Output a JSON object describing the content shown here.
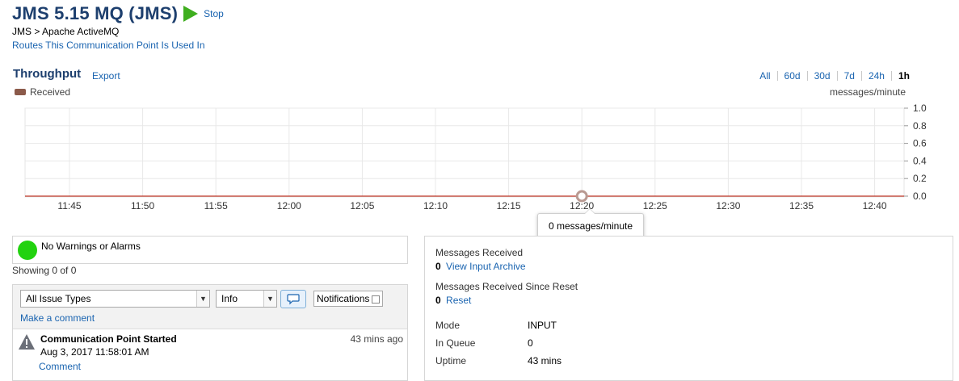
{
  "header": {
    "title": "JMS 5.15 MQ (JMS)",
    "stop_label": "Stop",
    "breadcrumb": "JMS > Apache ActiveMQ",
    "routes_link": "Routes This Communication Point Is Used In"
  },
  "throughput": {
    "title": "Throughput",
    "export_label": "Export",
    "ranges": [
      "All",
      "60d",
      "30d",
      "7d",
      "24h",
      "1h"
    ],
    "active_range": "1h",
    "legend_label": "Received",
    "legend_color": "#8b5a4a",
    "unit_label": "messages/minute",
    "tooltip": "0 messages/minute"
  },
  "chart_data": {
    "type": "line",
    "x_ticks": [
      "11:45",
      "11:50",
      "11:55",
      "12:00",
      "12:05",
      "12:10",
      "12:15",
      "12:20",
      "12:25",
      "12:30",
      "12:35",
      "12:40"
    ],
    "y_ticks": [
      "0.0",
      "0.2",
      "0.4",
      "0.6",
      "0.8",
      "1.0"
    ],
    "ylim": [
      0,
      1
    ],
    "series": [
      {
        "name": "Received",
        "color": "#c0392b",
        "values": [
          0,
          0,
          0,
          0,
          0,
          0,
          0,
          0,
          0,
          0,
          0,
          0
        ]
      }
    ],
    "highlight": {
      "x": "12:20",
      "y": 0
    },
    "grid": true
  },
  "status": {
    "warnings_text": "No Warnings or Alarms",
    "showing_text": "Showing 0 of 0"
  },
  "issues": {
    "type_select": "All Issue Types",
    "level_select": "Info",
    "notifications_label": "Notifications",
    "make_comment": "Make a comment",
    "events": [
      {
        "title": "Communication Point Started",
        "date": "Aug 3, 2017 11:58:01 AM",
        "ago": "43 mins ago",
        "comment_link": "Comment"
      }
    ]
  },
  "stats": {
    "messages_received_label": "Messages Received",
    "messages_received_value": "0",
    "view_archive_link": "View Input Archive",
    "since_reset_label": "Messages Received Since Reset",
    "since_reset_value": "0",
    "reset_link": "Reset",
    "mode_label": "Mode",
    "mode_value": "INPUT",
    "in_queue_label": "In Queue",
    "in_queue_value": "0",
    "uptime_label": "Uptime",
    "uptime_value": "43 mins"
  }
}
